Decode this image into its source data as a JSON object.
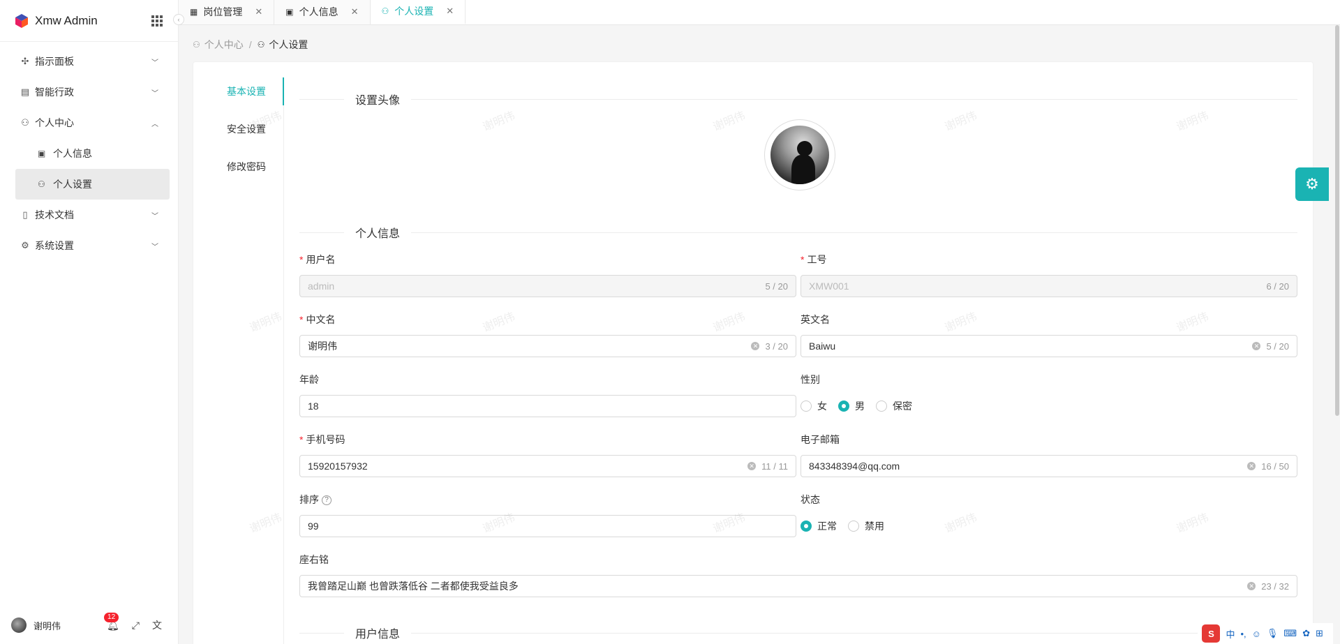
{
  "sidebar": {
    "brand": "Xmw Admin",
    "menu": [
      {
        "label": "指示面板",
        "icon": "dashboard-icon",
        "expanded": false
      },
      {
        "label": "智能行政",
        "icon": "building-icon",
        "expanded": false
      },
      {
        "label": "个人中心",
        "icon": "user-icon",
        "expanded": true
      },
      {
        "label": "技术文档",
        "icon": "document-icon",
        "expanded": false
      },
      {
        "label": "系统设置",
        "icon": "gear-icon",
        "expanded": false
      }
    ],
    "submenu": [
      {
        "label": "个人信息",
        "icon": "id-card-icon"
      },
      {
        "label": "个人设置",
        "icon": "user-settings-icon",
        "active": true
      }
    ],
    "footer": {
      "username": "谢明伟",
      "notification_count": "12"
    }
  },
  "tabs": [
    {
      "label": "岗位管理",
      "icon": "contact-icon"
    },
    {
      "label": "个人信息",
      "icon": "id-card-icon"
    },
    {
      "label": "个人设置",
      "icon": "user-settings-icon",
      "active": true
    }
  ],
  "breadcrumb": {
    "parent": "个人中心",
    "current": "个人设置"
  },
  "subnav": [
    "基本设置",
    "安全设置",
    "修改密码"
  ],
  "sections": {
    "avatar": "设置头像",
    "personal": "个人信息",
    "user": "用户信息"
  },
  "form": {
    "username": {
      "label": "用户名",
      "value": "admin",
      "count": "5 / 20"
    },
    "job_no": {
      "label": "工号",
      "value": "XMW001",
      "count": "6 / 20"
    },
    "cn_name": {
      "label": "中文名",
      "value": "谢明伟",
      "count": "3 / 20"
    },
    "en_name": {
      "label": "英文名",
      "value": "Baiwu",
      "count": "5 / 20"
    },
    "age": {
      "label": "年龄",
      "value": "18"
    },
    "gender": {
      "label": "性别",
      "options": [
        "女",
        "男",
        "保密"
      ],
      "selected": "男"
    },
    "phone": {
      "label": "手机号码",
      "value": "15920157932",
      "count": "11 / 11"
    },
    "email": {
      "label": "电子邮箱",
      "value": "843348394@qq.com",
      "count": "16 / 50"
    },
    "sort": {
      "label": "排序",
      "value": "99"
    },
    "status": {
      "label": "状态",
      "options": [
        "正常",
        "禁用"
      ],
      "selected": "正常"
    },
    "motto": {
      "label": "座右铭",
      "value": "我曾踏足山巅 也曾跌落低谷 二者都使我受益良多",
      "count": "23 / 32"
    }
  },
  "watermark": "谢明伟",
  "ime": {
    "logo": "S",
    "lang": "中"
  },
  "colors": {
    "accent": "#1ab3b3",
    "required": "#f5222d"
  }
}
